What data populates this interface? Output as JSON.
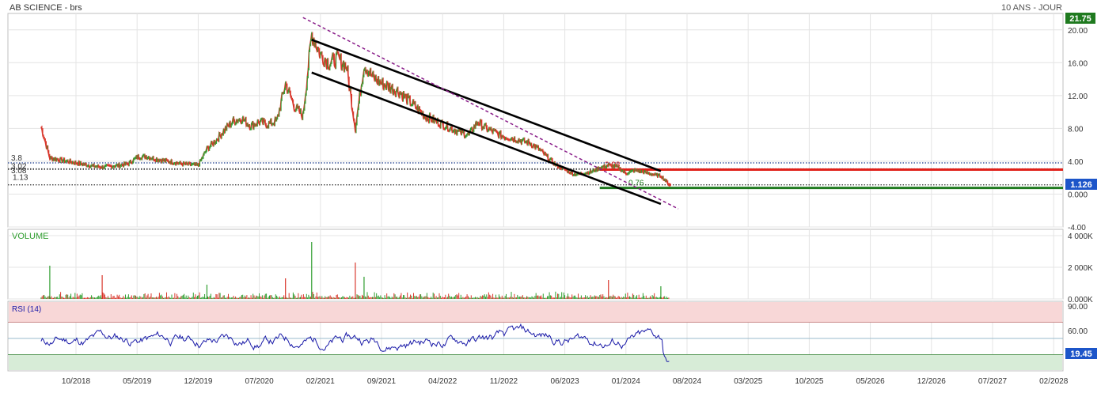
{
  "header": {
    "title": "AB SCIENCE - brs",
    "period": "10 ANS - JOUR"
  },
  "colors": {
    "up": "#2f9e2f",
    "down": "#d9362b",
    "rsi_line": "#1a1aa8",
    "trend": "#000000",
    "dotted_trend": "#8a1e8a",
    "resistance": "#e0201a",
    "support": "#1f7a1f",
    "last_price_bg": "#1c55c9",
    "high_bg": "#1f7a1f",
    "rsi_overbought_fill": "#f8d7d7",
    "rsi_oversold_fill": "#d7ecd7"
  },
  "chart_data": [
    {
      "type": "line",
      "panel": "price",
      "y_ticks": [
        "20.00",
        "16.00",
        "12.00",
        "8.00",
        "4.00",
        "0.000",
        "-4.00"
      ],
      "ylim": [
        -4,
        22
      ],
      "x_ticks": [
        "10/2018",
        "05/2019",
        "12/2019",
        "07/2020",
        "02/2021",
        "09/2021",
        "04/2022",
        "11/2022",
        "06/2023",
        "01/2024",
        "08/2024",
        "03/2025",
        "10/2025",
        "05/2026",
        "12/2026",
        "07/2027",
        "02/2028"
      ],
      "badges": {
        "high": "21.75",
        "last": "1.126"
      },
      "level_labels": [
        "3.8",
        "3.02",
        "3.08",
        "1.13",
        "2.98",
        "0.76"
      ],
      "levels": [
        {
          "value": 3.8,
          "style": "dotted",
          "color": "#1a3a8a"
        },
        {
          "value": 3.08,
          "style": "dotted",
          "color": "#333333"
        },
        {
          "value": 3.02,
          "style": "dotted",
          "color": "#333333"
        },
        {
          "value": 1.13,
          "style": "dotted",
          "color": "#333333"
        },
        {
          "value": 2.98,
          "style": "solid",
          "color": "#e0201a"
        },
        {
          "value": 0.76,
          "style": "solid",
          "color": "#1f7a1f"
        }
      ],
      "series": [
        {
          "x": [
            "2018-06",
            "2018-07",
            "2018-08",
            "2018-09",
            "2018-10",
            "2018-11",
            "2018-12",
            "2019-01",
            "2019-02",
            "2019-03",
            "2019-04",
            "2019-05",
            "2019-06",
            "2019-07",
            "2019-08",
            "2019-09",
            "2019-10",
            "2019-11",
            "2019-12",
            "2020-01",
            "2020-02",
            "2020-03",
            "2020-04",
            "2020-05",
            "2020-06",
            "2020-07",
            "2020-08",
            "2020-09",
            "2020-10",
            "2020-11",
            "2020-12",
            "2021-01",
            "2021-02",
            "2021-03",
            "2021-04",
            "2021-05",
            "2021-06",
            "2021-07",
            "2021-08",
            "2021-09",
            "2021-10",
            "2021-11",
            "2021-12",
            "2022-01",
            "2022-02",
            "2022-03",
            "2022-04",
            "2022-05",
            "2022-06",
            "2022-07",
            "2022-08",
            "2022-09",
            "2022-10",
            "2022-11",
            "2022-12",
            "2023-01",
            "2023-02",
            "2023-03",
            "2023-04",
            "2023-05",
            "2023-06",
            "2023-07",
            "2023-08",
            "2023-09",
            "2023-10",
            "2023-11",
            "2023-12",
            "2024-01",
            "2024-02",
            "2024-03",
            "2024-04",
            "2024-05",
            "2024-06"
          ],
          "values": [
            8.2,
            4.4,
            4.2,
            4.0,
            3.8,
            3.6,
            3.4,
            3.3,
            3.4,
            3.5,
            3.7,
            4.5,
            4.6,
            4.3,
            4.1,
            3.9,
            3.7,
            3.6,
            3.5,
            5.5,
            6.5,
            7.8,
            8.9,
            9.2,
            8.3,
            8.8,
            8.5,
            8.9,
            13.5,
            10.7,
            9.5,
            19.5,
            17.0,
            16.0,
            16.5,
            15.5,
            8.0,
            15.8,
            14.2,
            13.5,
            13.0,
            12.5,
            11.5,
            10.5,
            9.5,
            9.0,
            8.5,
            8.0,
            7.5,
            7.2,
            8.8,
            8.0,
            7.5,
            7.0,
            6.8,
            6.5,
            6.2,
            5.5,
            4.5,
            3.5,
            3.0,
            2.4,
            2.5,
            2.7,
            3.2,
            3.5,
            3.3,
            2.5,
            2.9,
            2.7,
            2.4,
            2.2,
            1.126
          ]
        }
      ]
    },
    {
      "type": "bar",
      "panel": "volume",
      "title": "VOLUME",
      "y_ticks": [
        "4 000K",
        "2 000K",
        "0.000K"
      ],
      "ylim": [
        0,
        4000000
      ],
      "spikes": [
        {
          "x": "2018-07",
          "value": 2100000
        },
        {
          "x": "2019-01",
          "value": 1500000
        },
        {
          "x": "2020-01",
          "value": 900000
        },
        {
          "x": "2020-10",
          "value": 1300000
        },
        {
          "x": "2021-01",
          "value": 3600000
        },
        {
          "x": "2021-06",
          "value": 2300000
        },
        {
          "x": "2021-07",
          "value": 1400000
        },
        {
          "x": "2023-11",
          "value": 1200000
        },
        {
          "x": "2024-05",
          "value": 800000
        }
      ]
    },
    {
      "type": "line",
      "panel": "rsi",
      "title": "RSI (14)",
      "y_ticks": [
        "90.00",
        "60.00"
      ],
      "ylim": [
        10,
        90
      ],
      "overbought": 70,
      "oversold": 30,
      "last_value": "19.45"
    }
  ]
}
